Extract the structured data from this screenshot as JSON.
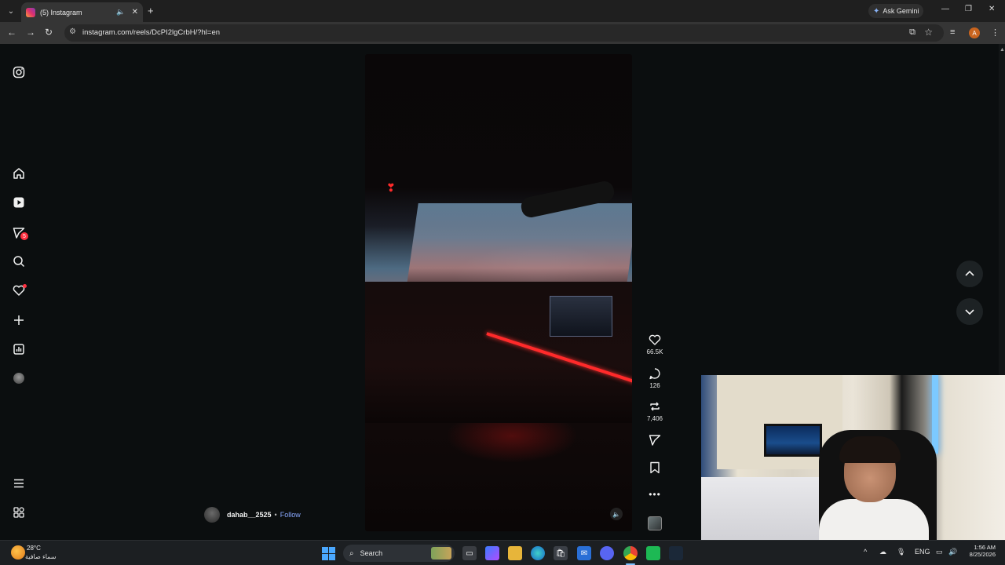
{
  "browser": {
    "tab_title": "(5) Instagram",
    "url": "instagram.com/reels/DcPI2lgCrbH/?hl=en",
    "gemini_label": "Ask Gemini",
    "profile_initial": "A"
  },
  "sidebar": {
    "notifications_badge": "5"
  },
  "reel": {
    "likes": "66.5K",
    "comments": "126",
    "reposts": "7,406",
    "author": "dahab__2525",
    "separator": "•",
    "follow_label": "Follow"
  },
  "taskbar": {
    "temperature": "28°C",
    "weather_desc": "سماء صافية",
    "search_placeholder": "Search",
    "language": "ENG",
    "time": "1:56 AM",
    "date": "8/25/2026"
  },
  "colors": {
    "accent_link": "#8aa9ff",
    "badge_red": "#ff3040",
    "page_bg": "#0b0e0f"
  },
  "icons": [
    "instagram-icon",
    "home-icon",
    "reels-icon",
    "messages-icon",
    "search-icon",
    "notifications-icon",
    "create-icon",
    "dashboard-icon",
    "profile-icon",
    "menu-icon",
    "also-from-meta-icon",
    "like-icon",
    "comment-icon",
    "repost-icon",
    "share-icon",
    "save-icon",
    "more-icon"
  ]
}
